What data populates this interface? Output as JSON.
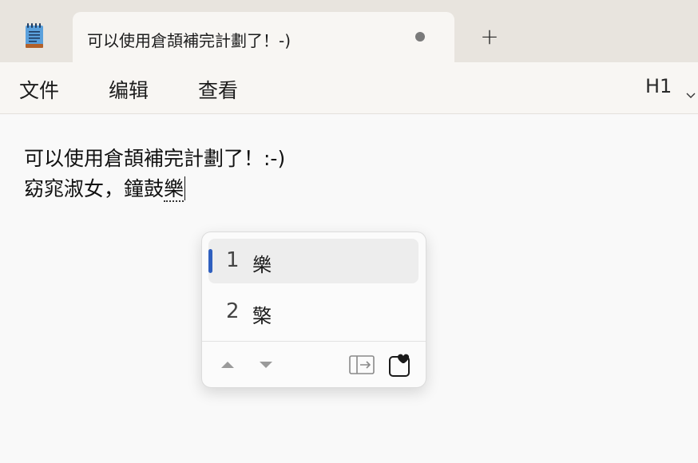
{
  "window": {
    "app_icon": "notepad-icon",
    "tab": {
      "title": "可以使用倉頡補完計劃了！-)",
      "unsaved_indicator": "dot",
      "close_icon": "dot-icon"
    },
    "new_tab_label": "+"
  },
  "menubar": {
    "items": [
      {
        "label": "文件"
      },
      {
        "label": "编辑"
      },
      {
        "label": "查看"
      }
    ],
    "heading_select": {
      "value": "H1",
      "icon": "chevron-down-icon"
    }
  },
  "editor": {
    "lines": [
      "可以使用倉頡補完計劃了！:-)",
      "窈窕淑女，鐘鼓"
    ],
    "composing_text": "樂"
  },
  "ime_candidates": {
    "items": [
      {
        "number": "1",
        "char": "樂",
        "selected": true
      },
      {
        "number": "2",
        "char": "檠",
        "selected": false
      }
    ],
    "buttons": {
      "prev": "triangle-up-icon",
      "next": "triangle-down-icon",
      "expand": "expand-panel-icon",
      "favorite": "clipboard-heart-icon"
    },
    "accent_color": "#2f5fbf"
  }
}
